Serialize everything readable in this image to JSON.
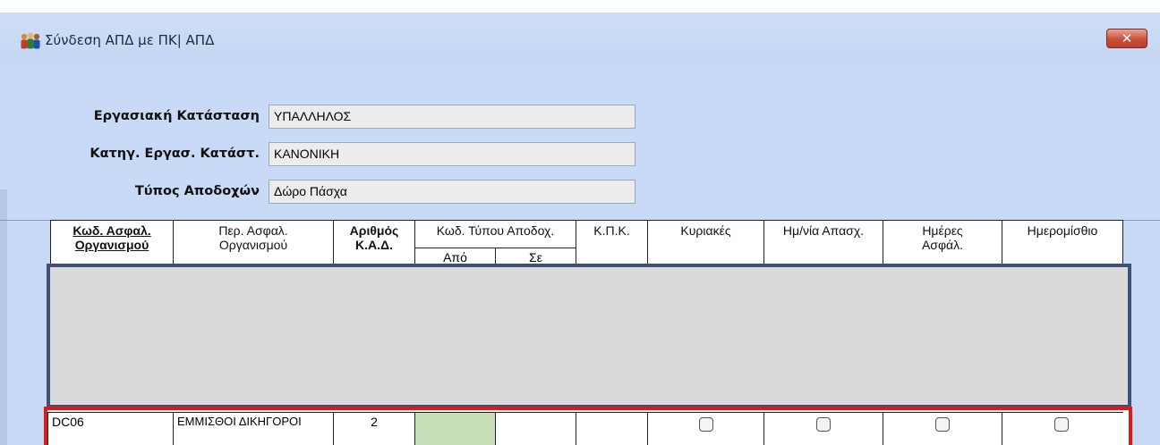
{
  "window": {
    "title": "Σύνδεση ΑΠΔ με ΠΚ| ΑΠΔ",
    "close_label": "✕"
  },
  "form": {
    "fields": [
      {
        "label": "Εργασιακή Κατάσταση",
        "value": "ΥΠΑΛΛΗΛΟΣ"
      },
      {
        "label": "Κατηγ. Εργασ. Κατάστ.",
        "value": "ΚΑΝΟΝΙΚΗ"
      },
      {
        "label": "Τύπος Αποδοχών",
        "value": "Δώρο Πάσχα"
      }
    ]
  },
  "grid": {
    "headers": {
      "org_code": [
        "Κωδ. Ασφαλ.",
        "Οργανισμού"
      ],
      "org_desc": [
        "Περ. Ασφαλ.",
        "Οργανισμού"
      ],
      "kad": [
        "Αριθμός",
        "Κ.Α.Δ."
      ],
      "pay_type_code": "Κωδ. Τύπου Αποδοχ.",
      "from": "Από",
      "to": "Σε",
      "kpk": "Κ.Π.Κ.",
      "sundays": "Κυριακές",
      "employment_date": "Ημ/νία Απασχ.",
      "insured_days": [
        "Ημέρες",
        "Ασφάλ."
      ],
      "daily_wage": "Ημερομίσθιο"
    },
    "row": {
      "org_code": "DC06",
      "org_desc": "ΕΜΜΙΣΘΟΙ ΔΙΚΗΓΟΡΟΙ",
      "kad": "2",
      "from": "",
      "to": "",
      "kpk": ""
    }
  },
  "icons": {
    "app": "people-group-icon",
    "close": "close-icon"
  },
  "colors": {
    "window_bg": "#c9daf6",
    "highlight_red": "#e01818",
    "highlight_navy": "#3d5278",
    "cell_green": "#c6dfb8"
  }
}
